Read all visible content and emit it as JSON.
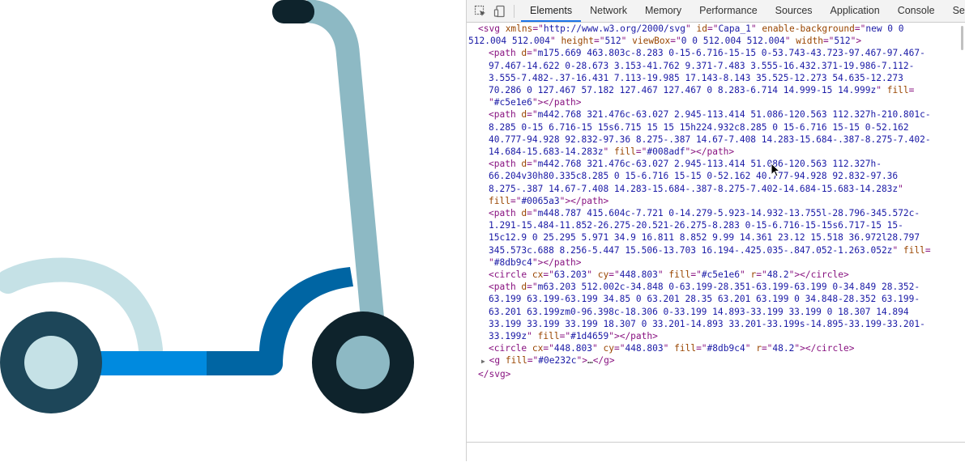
{
  "tabs": [
    {
      "label": "Elements",
      "active": true
    },
    {
      "label": "Network",
      "active": false
    },
    {
      "label": "Memory",
      "active": false
    },
    {
      "label": "Performance",
      "active": false
    },
    {
      "label": "Sources",
      "active": false
    },
    {
      "label": "Application",
      "active": false
    },
    {
      "label": "Console",
      "active": false
    },
    {
      "label": "Se",
      "active": false
    }
  ],
  "toolbar": {
    "inspect_icon": "inspect-element-icon",
    "device_icon": "device-toolbar-icon"
  },
  "code_lines": [
    {
      "indent": 1,
      "tokens": [
        [
          "tag",
          "<svg "
        ],
        [
          "an",
          "xmlns"
        ],
        [
          "tag",
          "=\""
        ],
        [
          "av",
          "http://www.w3.org/2000/svg"
        ],
        [
          "tag",
          "\" "
        ],
        [
          "an",
          "id"
        ],
        [
          "tag",
          "=\""
        ],
        [
          "av",
          "Capa_1"
        ],
        [
          "tag",
          "\" "
        ],
        [
          "an",
          "enable-background"
        ],
        [
          "tag",
          "=\""
        ],
        [
          "av",
          "new 0 0"
        ]
      ]
    },
    {
      "indent": 0,
      "tokens": [
        [
          "av",
          "512.004 512.004"
        ],
        [
          "tag",
          "\" "
        ],
        [
          "an",
          "height"
        ],
        [
          "tag",
          "=\""
        ],
        [
          "av",
          "512"
        ],
        [
          "tag",
          "\" "
        ],
        [
          "an",
          "viewBox"
        ],
        [
          "tag",
          "=\""
        ],
        [
          "av",
          "0 0 512.004 512.004"
        ],
        [
          "tag",
          "\" "
        ],
        [
          "an",
          "width"
        ],
        [
          "tag",
          "=\""
        ],
        [
          "av",
          "512"
        ],
        [
          "tag",
          "\">"
        ]
      ]
    },
    {
      "indent": 3,
      "tokens": [
        [
          "tag",
          "<path "
        ],
        [
          "an",
          "d"
        ],
        [
          "tag",
          "=\""
        ],
        [
          "av",
          "m175.669 463.803c-8.283 0-15-6.716-15-15 0-53.743-43.723-97.467-97.467-"
        ]
      ]
    },
    {
      "indent": 3,
      "tokens": [
        [
          "av",
          "97.467-14.622 0-28.673 3.153-41.762 9.371-7.483 3.555-16.432.371-19.986-7.112-"
        ]
      ]
    },
    {
      "indent": 3,
      "tokens": [
        [
          "av",
          "3.555-7.482-.37-16.431 7.113-19.985 17.143-8.143 35.525-12.273 54.635-12.273"
        ]
      ]
    },
    {
      "indent": 3,
      "tokens": [
        [
          "av",
          "70.286 0 127.467 57.182 127.467 127.467 0 8.283-6.714 14.999-15 14.999z"
        ],
        [
          "tag",
          "\" "
        ],
        [
          "an",
          "fill"
        ],
        [
          "tag",
          "="
        ]
      ]
    },
    {
      "indent": 3,
      "tokens": [
        [
          "tag",
          "\""
        ],
        [
          "av",
          "#c5e1e6"
        ],
        [
          "tag",
          "\"></path>"
        ]
      ]
    },
    {
      "indent": 3,
      "tokens": [
        [
          "tag",
          "<path "
        ],
        [
          "an",
          "d"
        ],
        [
          "tag",
          "=\""
        ],
        [
          "av",
          "m442.768 321.476c-63.027 2.945-113.414 51.086-120.563 112.327h-210.801c-"
        ]
      ]
    },
    {
      "indent": 3,
      "tokens": [
        [
          "av",
          "8.285 0-15 6.716-15 15s6.715 15 15 15h224.932c8.285 0 15-6.716 15-15 0-52.162"
        ]
      ]
    },
    {
      "indent": 3,
      "tokens": [
        [
          "av",
          "40.777-94.928 92.832-97.36 8.275-.387 14.67-7.408 14.283-15.684-.387-8.275-7.402-"
        ]
      ]
    },
    {
      "indent": 3,
      "tokens": [
        [
          "av",
          "14.684-15.683-14.283z"
        ],
        [
          "tag",
          "\" "
        ],
        [
          "an",
          "fill"
        ],
        [
          "tag",
          "=\""
        ],
        [
          "av",
          "#008adf"
        ],
        [
          "tag",
          "\"></path>"
        ]
      ]
    },
    {
      "indent": 3,
      "tokens": [
        [
          "tag",
          "<path "
        ],
        [
          "an",
          "d"
        ],
        [
          "tag",
          "=\""
        ],
        [
          "av",
          "m442.768 321.476c-63.027 2.945-113.414 51.086-120.563 112.327h-"
        ]
      ]
    },
    {
      "indent": 3,
      "tokens": [
        [
          "av",
          "66.204v30h80.335c8.285 0 15-6.716 15-15 0-52.162 40.777-94.928 92.832-97.36"
        ]
      ]
    },
    {
      "indent": 3,
      "tokens": [
        [
          "av",
          "8.275-.387 14.67-7.408 14.283-15.684-.387-8.275-7.402-14.684-15.683-14.283z"
        ],
        [
          "tag",
          "\""
        ]
      ]
    },
    {
      "indent": 3,
      "tokens": [
        [
          "an",
          "fill"
        ],
        [
          "tag",
          "=\""
        ],
        [
          "av",
          "#0065a3"
        ],
        [
          "tag",
          "\"></path>"
        ]
      ]
    },
    {
      "indent": 3,
      "tokens": [
        [
          "tag",
          "<path "
        ],
        [
          "an",
          "d"
        ],
        [
          "tag",
          "=\""
        ],
        [
          "av",
          "m448.787 415.604c-7.721 0-14.279-5.923-14.932-13.755l-28.796-345.572c-"
        ]
      ]
    },
    {
      "indent": 3,
      "tokens": [
        [
          "av",
          "1.291-15.484-11.852-26.275-20.521-26.275-8.283 0-15-6.716-15-15s6.717-15 15-"
        ]
      ]
    },
    {
      "indent": 3,
      "tokens": [
        [
          "av",
          "15c12.9 0 25.295 5.971 34.9 16.811 8.852 9.99 14.361 23.12 15.518 36.972l28.797"
        ]
      ]
    },
    {
      "indent": 3,
      "tokens": [
        [
          "av",
          "345.573c.688 8.256-5.447 15.506-13.703 16.194-.425.035-.847.052-1.263.052z"
        ],
        [
          "tag",
          "\" "
        ],
        [
          "an",
          "fill"
        ],
        [
          "tag",
          "="
        ]
      ]
    },
    {
      "indent": 3,
      "tokens": [
        [
          "tag",
          "\""
        ],
        [
          "av",
          "#8db9c4"
        ],
        [
          "tag",
          "\"></path>"
        ]
      ]
    },
    {
      "indent": 3,
      "tokens": [
        [
          "tag",
          "<circle "
        ],
        [
          "an",
          "cx"
        ],
        [
          "tag",
          "=\""
        ],
        [
          "av",
          "63.203"
        ],
        [
          "tag",
          "\" "
        ],
        [
          "an",
          "cy"
        ],
        [
          "tag",
          "=\""
        ],
        [
          "av",
          "448.803"
        ],
        [
          "tag",
          "\" "
        ],
        [
          "an",
          "fill"
        ],
        [
          "tag",
          "=\""
        ],
        [
          "av",
          "#c5e1e6"
        ],
        [
          "tag",
          "\" "
        ],
        [
          "an",
          "r"
        ],
        [
          "tag",
          "=\""
        ],
        [
          "av",
          "48.2"
        ],
        [
          "tag",
          "\"></circle>"
        ]
      ]
    },
    {
      "indent": 3,
      "tokens": [
        [
          "tag",
          "<path "
        ],
        [
          "an",
          "d"
        ],
        [
          "tag",
          "=\""
        ],
        [
          "av",
          "m63.203 512.002c-34.848 0-63.199-28.351-63.199-63.199 0-34.849 28.352-"
        ]
      ]
    },
    {
      "indent": 3,
      "tokens": [
        [
          "av",
          "63.199 63.199-63.199 34.85 0 63.201 28.35 63.201 63.199 0 34.848-28.352 63.199-"
        ]
      ]
    },
    {
      "indent": 3,
      "tokens": [
        [
          "av",
          "63.201 63.199zm0-96.398c-18.306 0-33.199 14.893-33.199 33.199 0 18.307 14.894"
        ]
      ]
    },
    {
      "indent": 3,
      "tokens": [
        [
          "av",
          "33.199 33.199 33.199 18.307 0 33.201-14.893 33.201-33.199s-14.895-33.199-33.201-"
        ]
      ]
    },
    {
      "indent": 3,
      "tokens": [
        [
          "av",
          "33.199z"
        ],
        [
          "tag",
          "\" "
        ],
        [
          "an",
          "fill"
        ],
        [
          "tag",
          "=\""
        ],
        [
          "av",
          "#1d4659"
        ],
        [
          "tag",
          "\"></path>"
        ]
      ]
    },
    {
      "indent": 3,
      "tokens": [
        [
          "tag",
          "<circle "
        ],
        [
          "an",
          "cx"
        ],
        [
          "tag",
          "=\""
        ],
        [
          "av",
          "448.803"
        ],
        [
          "tag",
          "\" "
        ],
        [
          "an",
          "cy"
        ],
        [
          "tag",
          "=\""
        ],
        [
          "av",
          "448.803"
        ],
        [
          "tag",
          "\" "
        ],
        [
          "an",
          "fill"
        ],
        [
          "tag",
          "=\""
        ],
        [
          "av",
          "#8db9c4"
        ],
        [
          "tag",
          "\" "
        ],
        [
          "an",
          "r"
        ],
        [
          "tag",
          "=\""
        ],
        [
          "av",
          "48.2"
        ],
        [
          "tag",
          "\"></circle>"
        ]
      ]
    },
    {
      "indent": 2,
      "arrow": "▶",
      "tokens": [
        [
          "tag",
          "<g "
        ],
        [
          "an",
          "fill"
        ],
        [
          "tag",
          "=\""
        ],
        [
          "av",
          "#0e232c"
        ],
        [
          "tag",
          "\">"
        ],
        [
          "tx",
          "…"
        ],
        [
          "tag",
          "</g>"
        ]
      ]
    },
    {
      "indent": 1,
      "tokens": [
        [
          "tag",
          "</svg>"
        ]
      ]
    }
  ],
  "colors": {
    "deck_light": "#008adf",
    "deck_dark": "#0065a3",
    "stem": "#8db9c4",
    "fender": "#c5e1e6",
    "wheel_outer": "#1d4659",
    "wheel_inner": "#c5e1e6",
    "handle": "#0e232c",
    "front_wheel_outer": "#0e232c",
    "front_wheel_inner": "#8db9c4"
  }
}
